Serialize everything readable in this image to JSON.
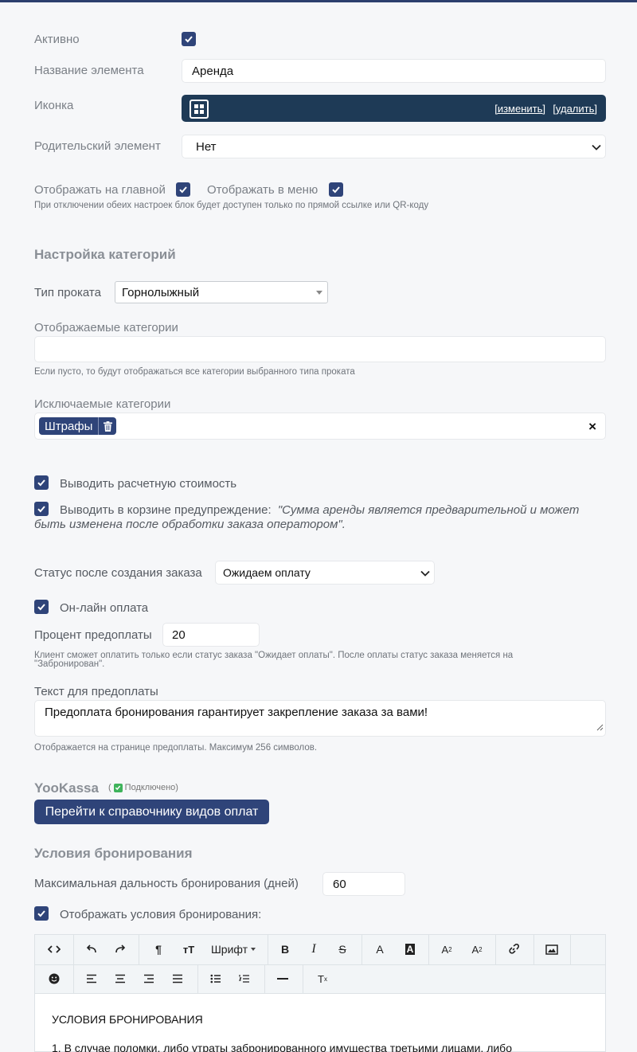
{
  "form": {
    "active_label": "Активно",
    "name_label": "Название элемента",
    "name_value": "Аренда",
    "icon_label": "Иконка",
    "icon_change": "[изменить]",
    "icon_delete": "[удалить]",
    "parent_label": "Родительский элемент",
    "parent_value": "Нет",
    "show_main_label": "Отображать на главной",
    "show_menu_label": "Отображать в меню",
    "visibility_hint": "При отключении обеих настроек блок будет доступен только по прямой ссылке или QR-коду"
  },
  "categories": {
    "heading": "Настройка категорий",
    "rental_type_label": "Тип проката",
    "rental_type_value": "Горнолыжный",
    "shown_label": "Отображаемые категории",
    "shown_hint": "Если пусто, то будут отображаться все категории выбранного типа проката",
    "excluded_label": "Исключаемые категории",
    "excluded_tag": "Штрафы",
    "clear_symbol": "×"
  },
  "options": {
    "show_cost_label": "Выводить расчетную стоимость",
    "cart_warning_prefix": "Выводить в корзине предупреждение:",
    "cart_warning_quote_1": "\"Сумма аренды является предварительной и может",
    "cart_warning_quote_2": "быть изменена после обработки заказа оператором\"."
  },
  "order": {
    "status_label": "Статус после создания заказа",
    "status_value": "Ожидаем оплату",
    "online_payment_label": "Он-лайн оплата",
    "prepay_percent_label": "Процент предоплаты",
    "prepay_percent_value": "20",
    "prepay_hint_1": "Клиент сможет оплатить только если статус заказа \"Ожидает оплаты\". После оплаты статус заказа меняется на",
    "prepay_hint_2": "\"Забронирован\".",
    "prepay_text_label": "Текст для предоплаты",
    "prepay_text_value": "Предоплата бронирования гарантирует закрепление заказа за вами!",
    "prepay_text_hint": "Отображается на странице предоплаты. Максимум 256 символов."
  },
  "yookassa": {
    "title": "YooKassa",
    "status_open": "(",
    "status_text": "Подключено)",
    "button_label": "Перейти к справочнику видов оплат"
  },
  "booking": {
    "heading": "Условия бронирования",
    "max_days_label": "Максимальная дальность бронирования (дней)",
    "max_days_value": "60",
    "show_terms_label": "Отображать условия бронирования:"
  },
  "editor": {
    "font_label": "Шрифт",
    "content_title": "УСЛОВИЯ БРОНИРОВАНИЯ",
    "content_line_1": "1. В случае поломки, либо утраты забронированного имущества третьими лицами, либо"
  },
  "colors": {
    "accent": "#2f4479",
    "icon_bar": "#1e3a56",
    "status_green": "#3fb35b"
  }
}
